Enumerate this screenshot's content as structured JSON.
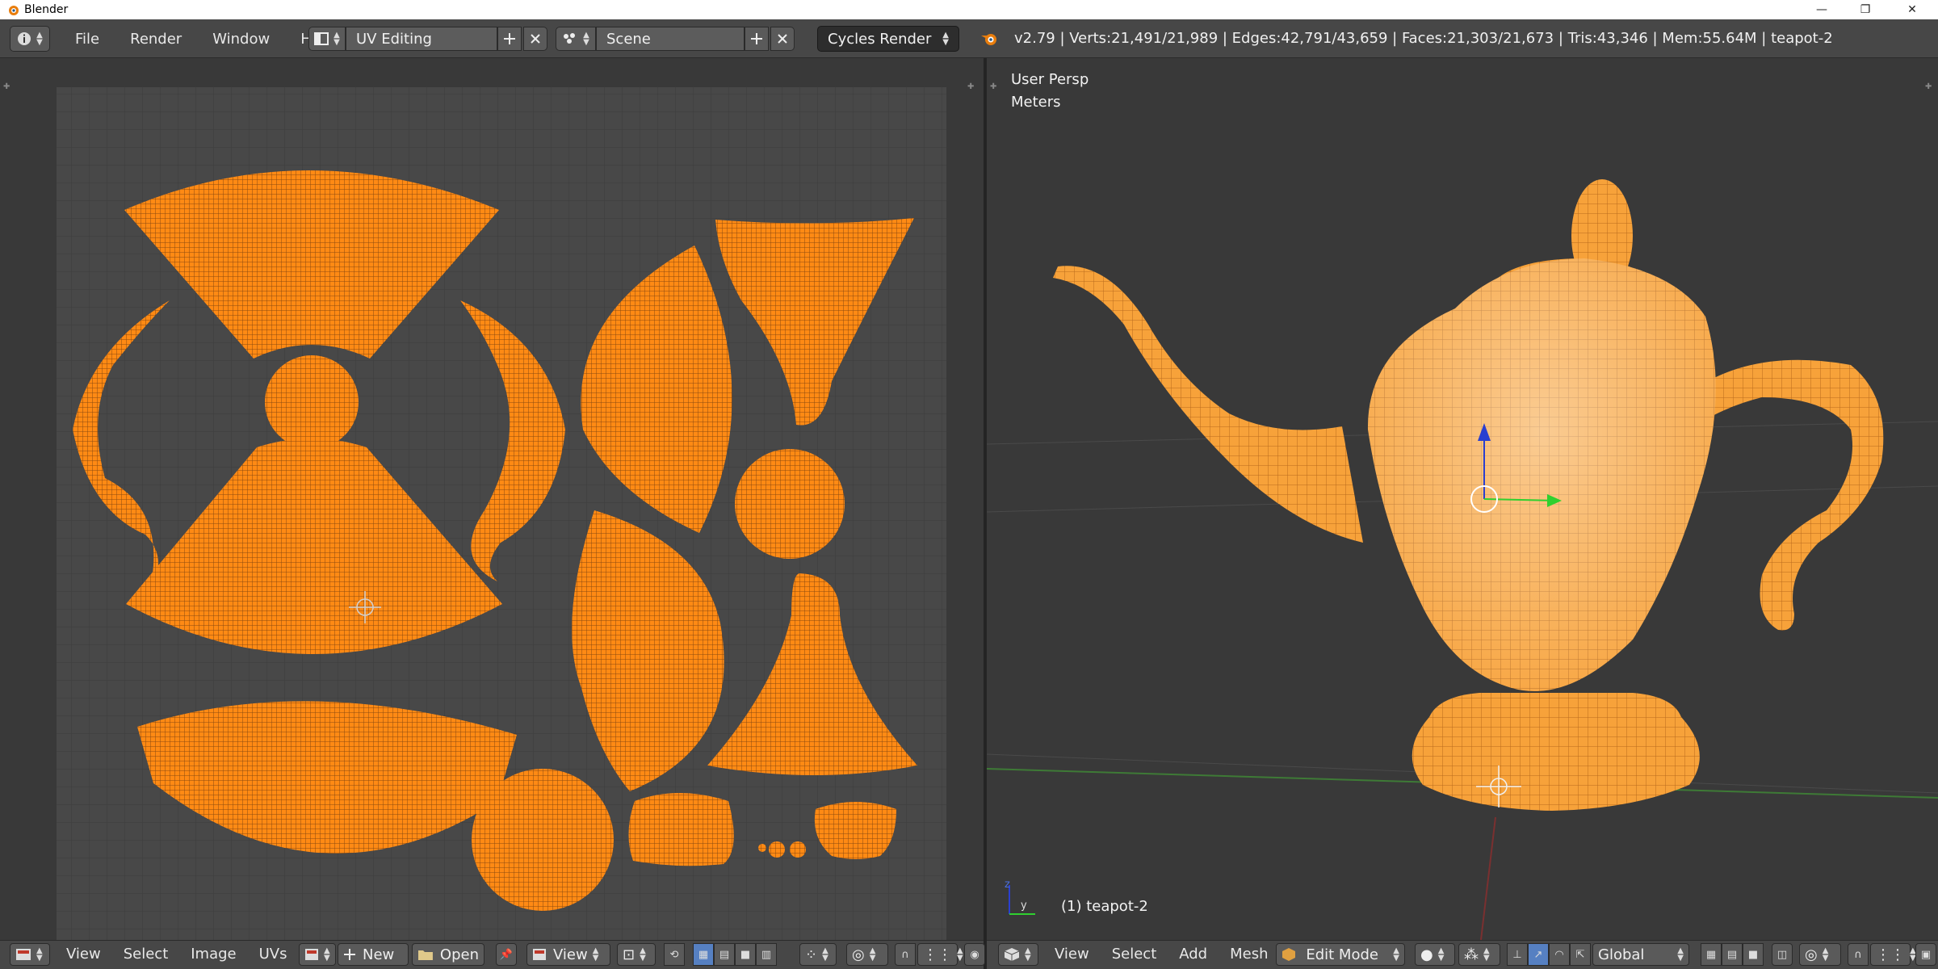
{
  "window": {
    "title": "Blender",
    "minimize": "—",
    "restore": "❐",
    "close": "✕"
  },
  "menus": [
    "File",
    "Render",
    "Window",
    "Help"
  ],
  "layout": {
    "name": "UV Editing",
    "icon": "screen-layout-icon"
  },
  "scene": {
    "name": "Scene",
    "icon": "scene-icon"
  },
  "engine": "Cycles Render",
  "stats": "v2.79 | Verts:21,491/21,989 | Edges:42,791/43,659 | Faces:21,303/21,673 | Tris:43,346 | Mem:55.64M | teapot-2",
  "viewport": {
    "view_name": "User Persp",
    "units": "Meters",
    "object_label": "(1) teapot-2",
    "axis_z": "z",
    "axis_y": "y"
  },
  "uv_header": {
    "menus": [
      "View",
      "Select",
      "Image",
      "UVs"
    ],
    "new_label": "New",
    "open_label": "Open",
    "view_label": "View"
  },
  "v3d_header": {
    "menus": [
      "View",
      "Select",
      "Add",
      "Mesh"
    ],
    "mode": "Edit Mode",
    "orientation": "Global"
  },
  "colors": {
    "uv_orange": "#ff8a14",
    "mesh_orange": "#f7a23a",
    "grid_bg": "#484848",
    "accent_blue": "#5680c2"
  }
}
